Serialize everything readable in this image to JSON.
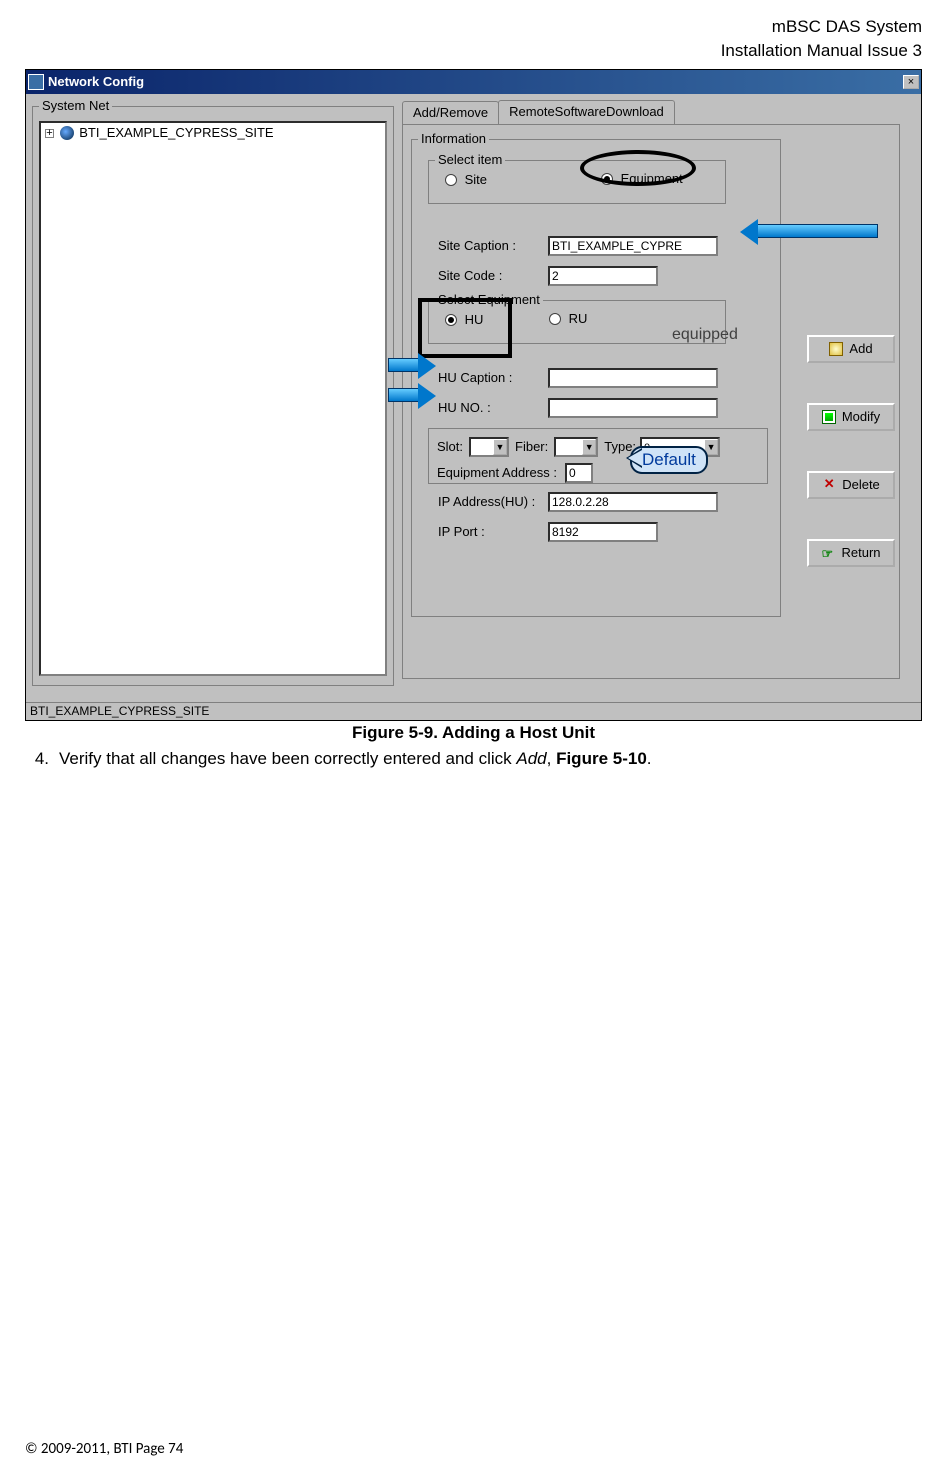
{
  "document": {
    "header_line1": "mBSC DAS System",
    "header_line2": "Installation Manual Issue 3",
    "figure_caption": "Figure 5-9. Adding a Host Unit",
    "step_number": "4.",
    "step_text_prefix": "Verify that all changes have been correctly entered and click ",
    "step_add_word": "Add",
    "step_text_mid": ", ",
    "step_fig_ref": "Figure 5-10",
    "step_text_suffix": ".",
    "footer": "© 2009-2011, BTI Page 74"
  },
  "window": {
    "title": "Network Config",
    "close_label": "×",
    "statusbar_text": "BTI_EXAMPLE_CYPRESS_SITE"
  },
  "system_net": {
    "group_title": "System Net",
    "tree_item": "BTI_EXAMPLE_CYPRESS_SITE",
    "expander": "+"
  },
  "tabs": {
    "active": "Add/Remove",
    "inactive": "RemoteSoftwareDownload"
  },
  "information": {
    "group_title": "Information",
    "select_item_title": "Select item",
    "radio_site": "Site",
    "radio_equipment": "Equipment",
    "site_caption_label": "Site Caption :",
    "site_caption_value": "BTI_EXAMPLE_CYPRE",
    "site_code_label": "Site Code :",
    "site_code_value": "2",
    "select_equip_title": "Select Equipment",
    "radio_hu": "HU",
    "radio_ru": "RU",
    "equipped_label": "equipped",
    "hu_caption_label": "HU Caption :",
    "hu_caption_value": "",
    "hu_no_label": "HU NO. :",
    "hu_no_value": "",
    "slot_label": "Slot:",
    "slot_value": "",
    "fiber_label": "Fiber:",
    "fiber_value": "",
    "type_label": "Type:",
    "type_value": "0",
    "equip_addr_label": "Equipment Address :",
    "equip_addr_value": "0",
    "ip_addr_label": "IP Address(HU) :",
    "ip_addr_value": "128.0.2.28",
    "ip_port_label": "IP Port :",
    "ip_port_value": "8192"
  },
  "buttons": {
    "add": "Add",
    "modify": "Modify",
    "delete": "Delete",
    "return": "Return"
  },
  "annotations": {
    "default_bubble": "Default"
  }
}
